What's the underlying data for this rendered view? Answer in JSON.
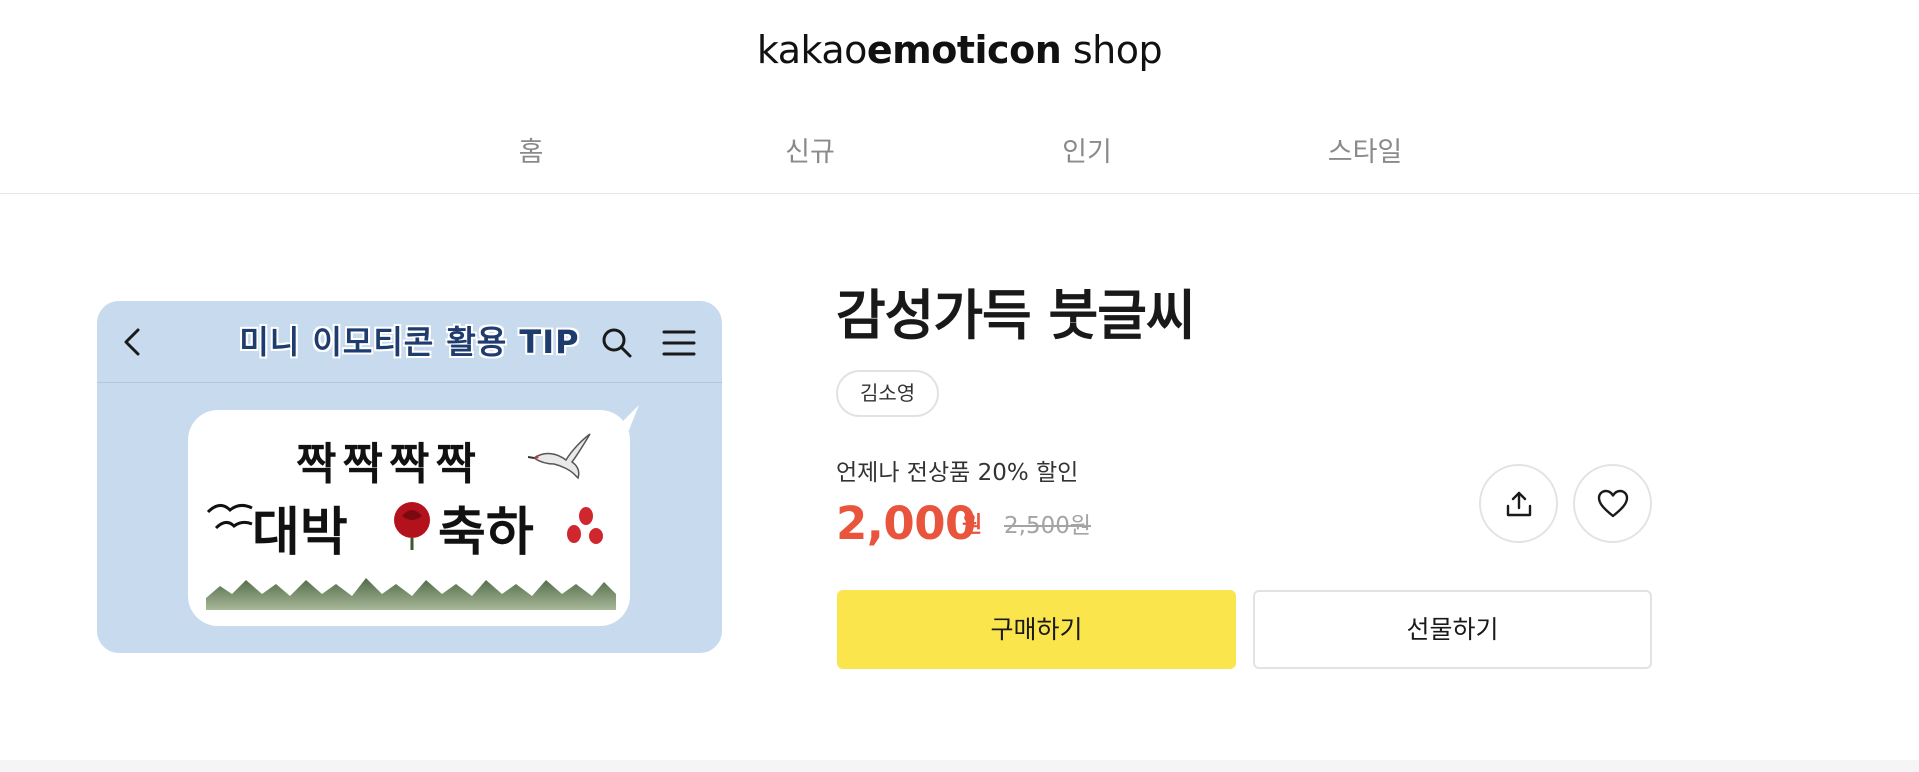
{
  "header": {
    "logo_prefix": "kakao",
    "logo_bold": "emoticon",
    "logo_suffix": " shop"
  },
  "nav": {
    "items": [
      {
        "label": "홈",
        "icon": "home"
      },
      {
        "label": "신규",
        "icon": "new"
      },
      {
        "label": "인기",
        "icon": "popular"
      },
      {
        "label": "스타일",
        "icon": "style"
      }
    ]
  },
  "preview": {
    "title": "미니 이모티콘 활용 TIP",
    "bubble_line1": "짝짝짝짝",
    "bubble_line2": "대박",
    "bubble_line3": "축하",
    "background_color": "#c7daee",
    "icons": [
      "back-icon",
      "search-icon",
      "menu-icon"
    ]
  },
  "product": {
    "title": "감성가득 붓글씨",
    "author": "김소영",
    "discount_text": "언제나 전상품 20% 할인",
    "price": "2,000",
    "price_unit": "원",
    "original_price": "2,500원",
    "price_color": "#e9543d"
  },
  "actions": {
    "share_icon": "share-icon",
    "like_icon": "heart-icon",
    "buy_label": "구매하기",
    "gift_label": "선물하기",
    "buy_color": "#fae54d"
  }
}
